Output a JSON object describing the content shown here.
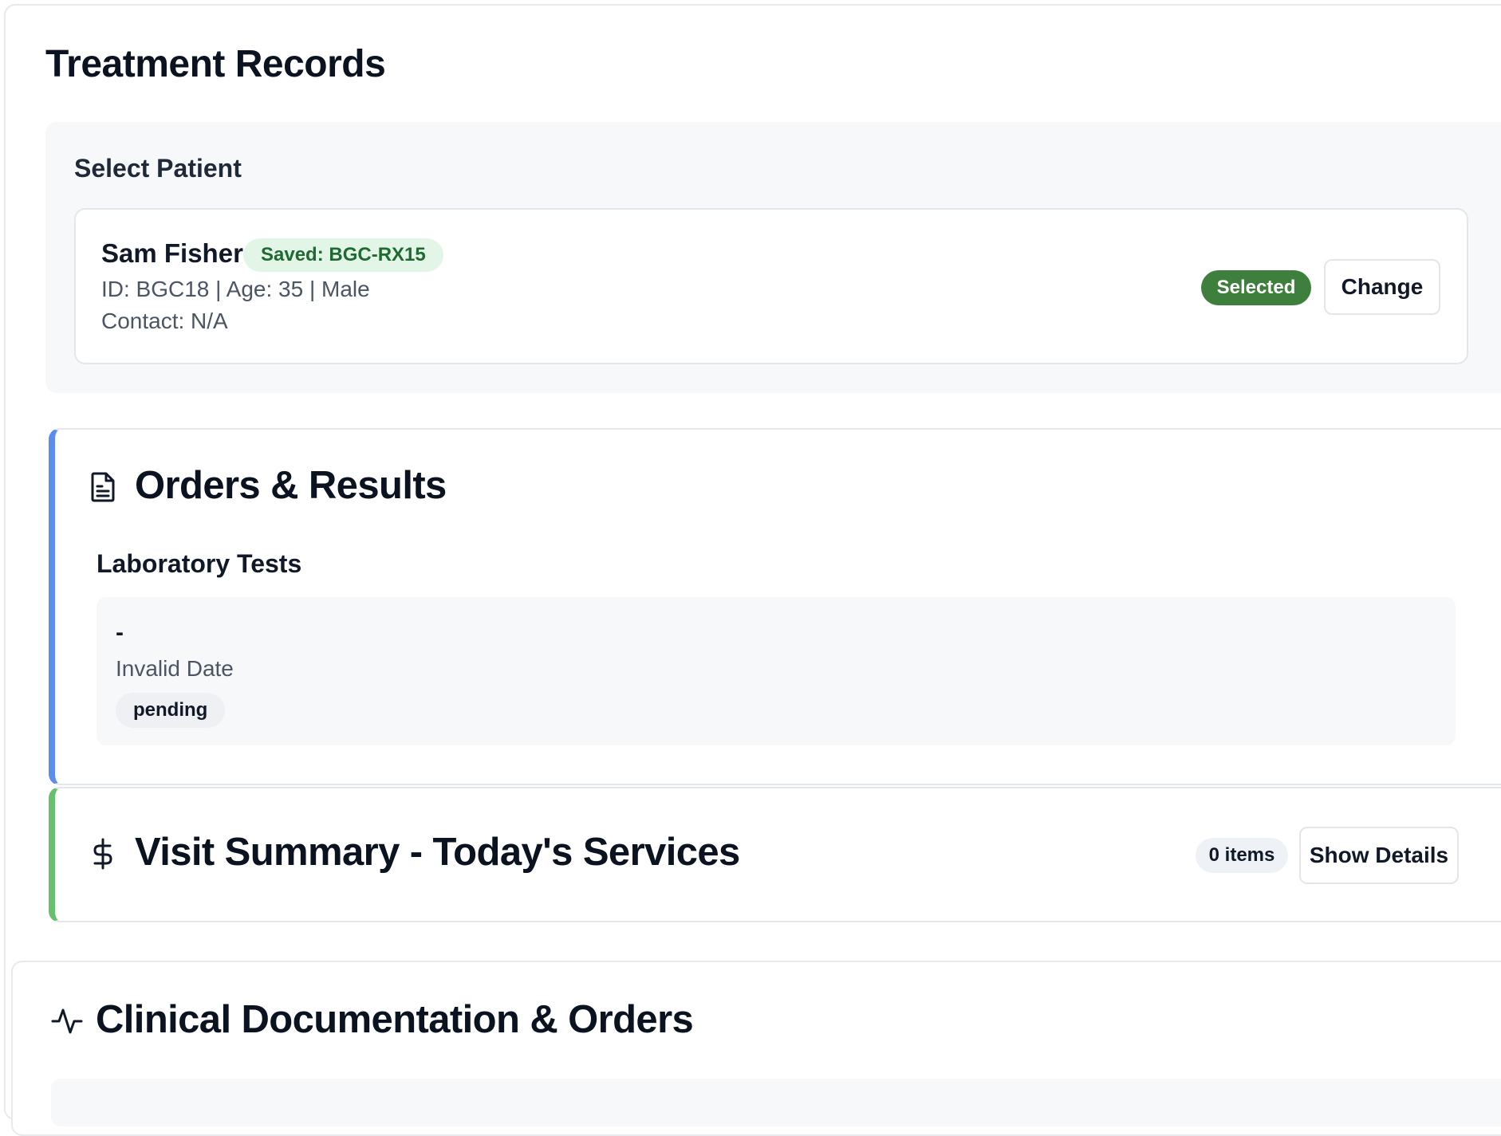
{
  "page": {
    "title": "Treatment Records"
  },
  "patient_panel": {
    "label": "Select Patient",
    "patient": {
      "name": "Sam Fisher",
      "saved_badge": "Saved: BGC-RX15",
      "meta": "ID: BGC18 | Age: 35 | Male",
      "contact": "Contact: N/A"
    },
    "selected_badge": "Selected",
    "change_label": "Change",
    "colors": {
      "selected_badge_bg": "#3f7f3e",
      "saved_badge_bg": "#e3f5e6"
    }
  },
  "orders_section": {
    "title": "Orders & Results",
    "icon": "document-icon",
    "accent": "#5b8def",
    "lab_heading": "Laboratory Tests",
    "lab_tests": [
      {
        "name": "-",
        "date": "Invalid Date",
        "status": "pending"
      }
    ]
  },
  "visit_section": {
    "title": "Visit Summary - Today's Services",
    "icon": "dollar-icon",
    "accent": "#66c06c",
    "items_badge": "0 items",
    "details_label": "Show Details"
  },
  "clinical_section": {
    "title": "Clinical Documentation & Orders",
    "icon": "activity-icon"
  }
}
